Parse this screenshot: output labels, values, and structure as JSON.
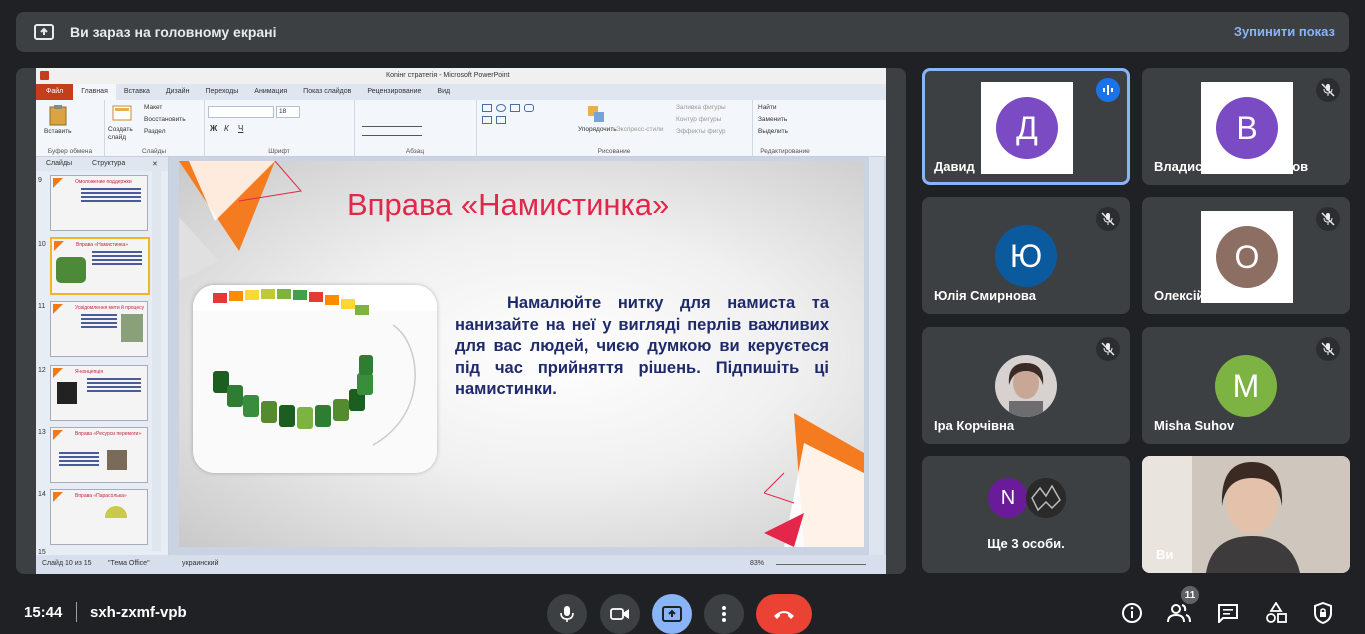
{
  "banner": {
    "text": "Ви зараз на головному екрані",
    "stop_label": "Зупинити показ"
  },
  "ppt": {
    "window_title": "Коnінг стрaтегія - Microsoft PowerPoint",
    "tabs": [
      "Файл",
      "Главная",
      "Вставка",
      "Дизайн",
      "Переходы",
      "Анимация",
      "Показ слайдов",
      "Рецензирование",
      "Вид"
    ],
    "ribbon": {
      "insert_label": "Вставить",
      "create_slide": "Создать слайд",
      "layout": "Макет",
      "reset": "Восстановить",
      "section": "Раздел",
      "font_size": "18",
      "arrange": "Упорядочить",
      "quick_styles": "Экспресс-стили",
      "fill": "Заливка фигуры",
      "outline": "Контур фигуры",
      "effects": "Эффекты фигур",
      "find": "Найти",
      "replace": "Заменить",
      "select": "Выделить",
      "groups": [
        "Буфер обмена",
        "Слайды",
        "Шрифт",
        "Абзац",
        "Рисование",
        "Редактирование"
      ]
    },
    "pane_tabs": [
      "Слайды",
      "Структура"
    ],
    "thumbnails": [
      {
        "num": "9",
        "title": "Омоложение поддержки"
      },
      {
        "num": "10",
        "title": "Вправа «Намистинка»"
      },
      {
        "num": "11",
        "title": "Усвідомлення мети й процесу"
      },
      {
        "num": "12",
        "title": "Я-концепція"
      },
      {
        "num": "13",
        "title": "Вправа «Ресурси перемоги»"
      },
      {
        "num": "14",
        "title": "Вправа «Парасолька»"
      },
      {
        "num": "15",
        "title": ""
      }
    ],
    "slide": {
      "title": "Вправа «Намистинка»",
      "body": "Намалюйте нитку для намиста та нанизайте на неї у вигляді перлів важливих для вас людей, чиєю думкою ви керуєтеся під час прийняття рішень. Підпишіть ці намистинки."
    },
    "status": {
      "slide": "Слайд 10 из 15",
      "theme": "\"Тема Office\"",
      "lang": "украинский",
      "zoom": "83%"
    }
  },
  "participants": [
    {
      "name": "Давид",
      "initial": "Д",
      "color": "#7b4bc4",
      "state": "speaking"
    },
    {
      "name": "Владислав Гребенніков",
      "initial": "В",
      "color": "#7b4bc4",
      "state": "muted"
    },
    {
      "name": "Юлія Смирнова",
      "initial": "Ю",
      "color": "#0b5a9e",
      "state": "muted"
    },
    {
      "name": "Олексій Швачко",
      "initial": "О",
      "color": "#8d6e63",
      "state": "muted"
    },
    {
      "name": "Іра Корчівна",
      "initial": "",
      "color": "#dedede",
      "state": "muted"
    },
    {
      "name": "Misha Suhov",
      "initial": "M",
      "color": "#7cb342",
      "state": "muted"
    }
  ],
  "others": {
    "label": "Ще 3 особи.",
    "initial": "N",
    "color": "#6a1b9a"
  },
  "self_tile": {
    "name": "Ви"
  },
  "bottom": {
    "time": "15:44",
    "meeting_code": "sxh-zxmf-vpb",
    "people_count": "11"
  },
  "colors": {
    "accent": "#8ab4f8",
    "bg": "#202124",
    "tile": "#3c4043",
    "end_call": "#ea4335"
  }
}
